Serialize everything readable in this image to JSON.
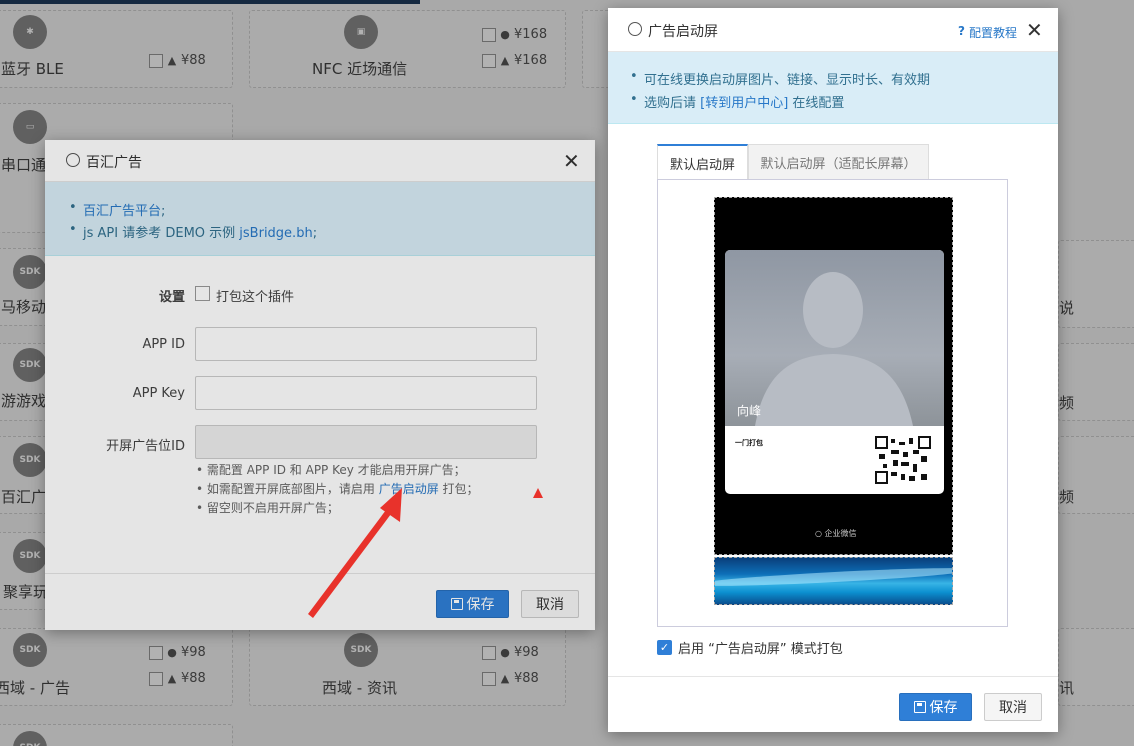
{
  "background": {
    "cards": [
      {
        "id": "ble",
        "icon": "bluetooth-icon",
        "icon_text": "✱",
        "title": "蓝牙 BLE",
        "prices": [
          {
            "os": "android",
            "price": "¥88"
          }
        ]
      },
      {
        "id": "nfc",
        "icon": "nfc-icon",
        "icon_text": "▣",
        "title": "NFC 近场通信",
        "prices": [
          {
            "os": "ios",
            "price": "¥168"
          },
          {
            "os": "android",
            "price": "¥168"
          }
        ]
      },
      {
        "id": "serial",
        "icon": "serial-port-icon",
        "icon_text": "▭",
        "title": "串口通"
      },
      {
        "id": "horse",
        "icon": "sdk-icon",
        "icon_text": "SDK",
        "title": "马移动"
      },
      {
        "id": "game",
        "icon": "sdk-icon",
        "icon_text": "SDK",
        "title": "游游戏"
      },
      {
        "id": "baihui",
        "icon": "sdk-icon",
        "icon_text": "SDK",
        "title": "百汇广"
      },
      {
        "id": "juxiang",
        "icon": "sdk-icon",
        "icon_text": "SDK",
        "title": "聚享玩"
      },
      {
        "id": "xiyu-ad",
        "icon": "sdk-icon",
        "icon_text": "SDK",
        "title": "西域 - 广告",
        "prices": [
          {
            "os": "ios",
            "price": "¥98"
          },
          {
            "os": "android",
            "price": "¥88"
          }
        ]
      },
      {
        "id": "xiyu-news",
        "icon": "sdk-icon",
        "icon_text": "SDK",
        "title": "西域 - 资讯",
        "prices": [
          {
            "os": "ios",
            "price": "¥98"
          },
          {
            "os": "android",
            "price": "¥88"
          }
        ]
      }
    ],
    "right_edge_labels": [
      "说",
      "频",
      "频",
      "讯"
    ]
  },
  "left_dialog": {
    "title": "百汇广告",
    "title_icon": "sdk-icon",
    "info": {
      "line1_link": "百汇广告平台",
      "line1_suffix": ";",
      "line2_prefix": "js API 请参考 DEMO 示例 ",
      "line2_link": "jsBridge.bh",
      "line2_suffix": ";"
    },
    "form": {
      "settings_label": "设置",
      "package_checkbox_label": "打包这个插件",
      "app_id_label": "APP ID",
      "app_id_value": "",
      "app_key_label": "APP Key",
      "app_key_value": "",
      "splash_id_label": "开屏广告位ID",
      "splash_id_value": "",
      "hints": [
        "• 需配置 APP ID 和 APP Key 才能启用开屏广告；",
        "• 留空则不启用开屏广告；"
      ],
      "hint2_prefix": "• 如需配置开屏底部图片，请启用 ",
      "hint2_link": "广告启动屏",
      "hint2_suffix": " 打包；"
    },
    "save_label": "保存",
    "cancel_label": "取消"
  },
  "right_dialog": {
    "title": "广告启动屏",
    "title_icon": "clock-icon",
    "help_link": "配置教程",
    "info": {
      "line1": "可在线更换启动屏图片、链接、显示时长、有效期",
      "line2_prefix": "选购后请 ",
      "line2_link": "[转到用户中心]",
      "line2_suffix": " 在线配置"
    },
    "tabs": [
      {
        "label": "默认启动屏",
        "active": true
      },
      {
        "label": "默认启动屏（适配长屏幕）",
        "active": false
      }
    ],
    "preview": {
      "person_name": "向峰",
      "company": "一门打包",
      "footer_brand": "企业微信"
    },
    "enable_label": "启用 “广告启动屏” 模式打包",
    "enable_checked": true,
    "save_label": "保存",
    "cancel_label": "取消"
  },
  "colors": {
    "primary": "#2f7fd7",
    "info_bg": "#d9edf7",
    "info_text": "#31708f",
    "arrow": "#e8322b"
  }
}
